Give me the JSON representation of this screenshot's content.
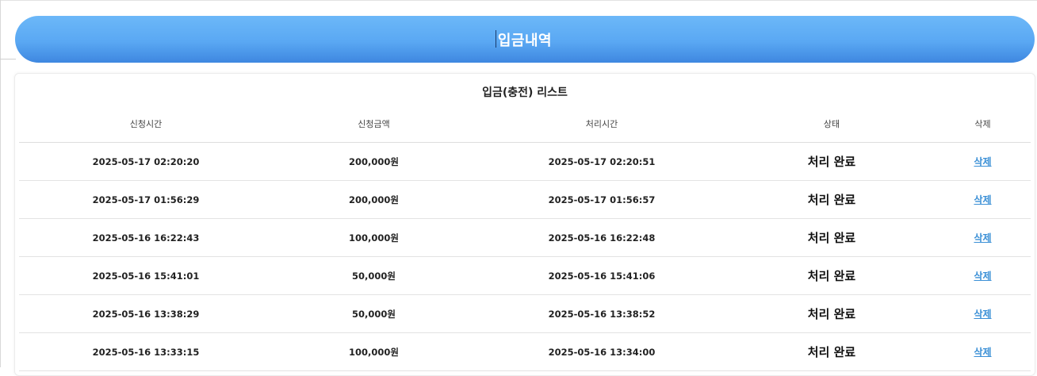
{
  "header": {
    "title": "입금내역"
  },
  "card": {
    "title": "입금(충전) 리스트"
  },
  "table": {
    "columns": [
      "신청시간",
      "신청금액",
      "처리시간",
      "상태",
      "삭제"
    ],
    "rows": [
      {
        "requested": "2025-05-17 02:20:20",
        "amount": "200,000원",
        "processed": "2025-05-17 02:20:51",
        "status": "처리 완료",
        "delete": "삭제"
      },
      {
        "requested": "2025-05-17 01:56:29",
        "amount": "200,000원",
        "processed": "2025-05-17 01:56:57",
        "status": "처리 완료",
        "delete": "삭제"
      },
      {
        "requested": "2025-05-16 16:22:43",
        "amount": "100,000원",
        "processed": "2025-05-16 16:22:48",
        "status": "처리 완료",
        "delete": "삭제"
      },
      {
        "requested": "2025-05-16 15:41:01",
        "amount": "50,000원",
        "processed": "2025-05-16 15:41:06",
        "status": "처리 완료",
        "delete": "삭제"
      },
      {
        "requested": "2025-05-16 13:38:29",
        "amount": "50,000원",
        "processed": "2025-05-16 13:38:52",
        "status": "처리 완료",
        "delete": "삭제"
      },
      {
        "requested": "2025-05-16 13:33:15",
        "amount": "100,000원",
        "processed": "2025-05-16 13:34:00",
        "status": "처리 완료",
        "delete": "삭제"
      }
    ]
  },
  "colors": {
    "header_gradient_top": "#6cb8f8",
    "header_gradient_bottom": "#3e87e0",
    "link": "#3a8fd6"
  }
}
